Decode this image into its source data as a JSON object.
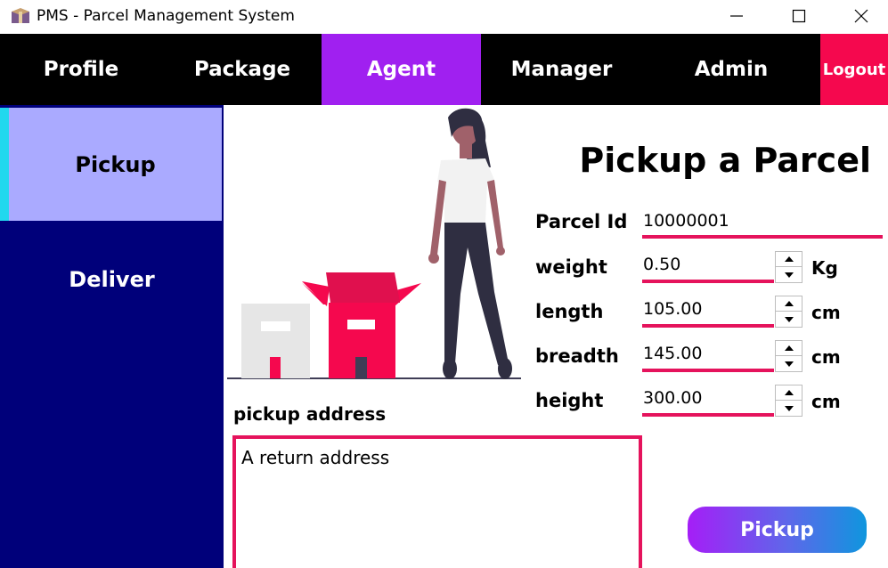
{
  "window": {
    "title": "PMS - Parcel Management System"
  },
  "nav": {
    "items": [
      {
        "label": "Profile"
      },
      {
        "label": "Package"
      },
      {
        "label": "Agent"
      },
      {
        "label": "Manager"
      },
      {
        "label": "Admin"
      },
      {
        "label": "Logout"
      }
    ],
    "active": "Agent"
  },
  "sidebar": {
    "items": [
      {
        "label": "Pickup"
      },
      {
        "label": "Deliver"
      }
    ],
    "active": "Pickup"
  },
  "form": {
    "title": "Pickup a Parcel",
    "parcel_id": {
      "label": "Parcel Id",
      "value": "10000001"
    },
    "weight": {
      "label": "weight",
      "value": "0.50",
      "unit": "Kg"
    },
    "length": {
      "label": "length",
      "value": "105.00",
      "unit": "cm"
    },
    "breadth": {
      "label": "breadth",
      "value": "145.00",
      "unit": "cm"
    },
    "height": {
      "label": "height",
      "value": "300.00",
      "unit": "cm"
    },
    "address": {
      "label": "pickup address",
      "value": "A return address"
    },
    "submit_label": "Pickup"
  },
  "colors": {
    "nav_bg": "#000000",
    "nav_active": "#a020f0",
    "logout": "#f5084e",
    "sidebar_bg": "#00007a",
    "sidebar_active": "#aaaaff",
    "sidebar_accent": "#22d8ee",
    "input_underline": "#e5135c"
  }
}
